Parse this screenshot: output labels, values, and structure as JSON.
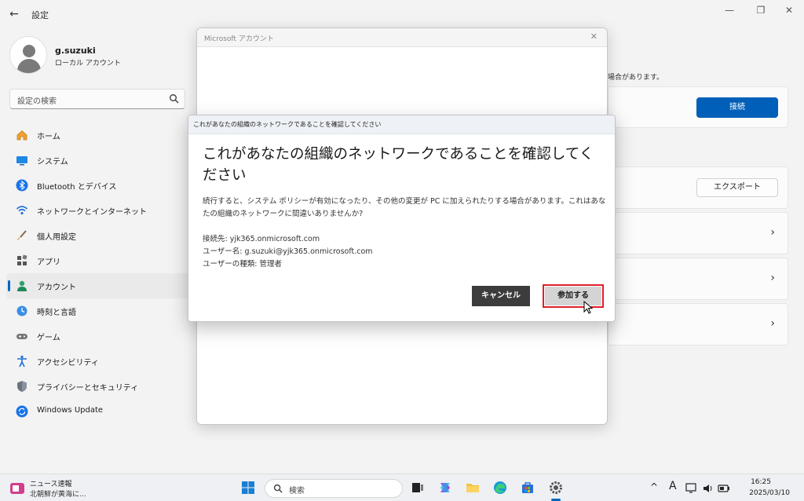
{
  "window": {
    "title": "設定",
    "back": "←",
    "minimize": "—",
    "maximize": "❐",
    "close": "✕"
  },
  "profile": {
    "name": "g.suzuki",
    "type": "ローカル アカウント"
  },
  "search": {
    "placeholder": "設定の検索"
  },
  "nav": [
    {
      "label": "ホーム"
    },
    {
      "label": "システム"
    },
    {
      "label": "Bluetooth とデバイス"
    },
    {
      "label": "ネットワークとインターネット"
    },
    {
      "label": "個人用設定"
    },
    {
      "label": "アプリ"
    },
    {
      "label": "アカウント"
    },
    {
      "label": "時刻と言語"
    },
    {
      "label": "ゲーム"
    },
    {
      "label": "アクセシビリティ"
    },
    {
      "label": "プライバシーとセキュリティ"
    },
    {
      "label": "Windows Update"
    }
  ],
  "background": {
    "hint": "場合があります。",
    "connect_label": "接続",
    "export_label": "エクスポート",
    "chevron": "›"
  },
  "ms_window": {
    "title": "Microsoft アカウント",
    "close": "✕"
  },
  "dialog": {
    "titlebar": "これがあなたの組織のネットワークであることを確認してください",
    "heading": "これがあなたの組織のネットワークであることを確認してください",
    "body": "続行すると、システム ポリシーが有効になったり、その他の変更が PC に加えられたりする場合があります。これはあなたの組織のネットワークに間違いありませんか?",
    "connect_to": "接続先: yjk365.onmicrosoft.com",
    "username": "ユーザー名: g.suzuki@yjk365.onmicrosoft.com",
    "user_type": "ユーザーの種類: 管理者",
    "cancel_label": "キャンセル",
    "join_label": "参加する"
  },
  "taskbar": {
    "news_title": "ニュース速報",
    "news_sub": "北朝鮮が黄海に...",
    "search_placeholder": "検索",
    "tray_chevron": "^",
    "tray_ime": "A",
    "time": "16:25",
    "date": "2025/03/10"
  }
}
